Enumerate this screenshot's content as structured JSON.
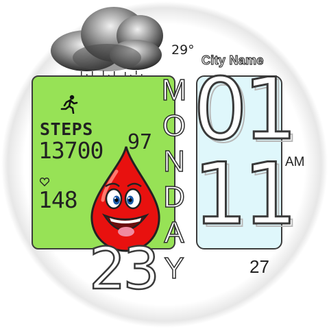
{
  "weather": {
    "icon": "rain-cloud-icon",
    "temperature": "29°",
    "city": "City Name"
  },
  "activity": {
    "icon": "running-person-icon",
    "steps_label": "STEPS",
    "steps_value": "13700",
    "steps_goal_percent": "97",
    "heart_icon": "heart-icon",
    "heart_rate": "148"
  },
  "mascot": {
    "icon": "blood-drop-mascot-icon"
  },
  "time": {
    "hour": "01",
    "minute": "11",
    "ampm": "AM",
    "seconds": "27"
  },
  "date": {
    "day_letters": [
      "M",
      "O",
      "N",
      "D",
      "A",
      "Y"
    ],
    "day_number": "23"
  },
  "colors": {
    "activity_panel": "#97e256",
    "time_panel": "#dff7fb",
    "mascot_red": "#e8110f",
    "outline": "#3c3c3c"
  }
}
